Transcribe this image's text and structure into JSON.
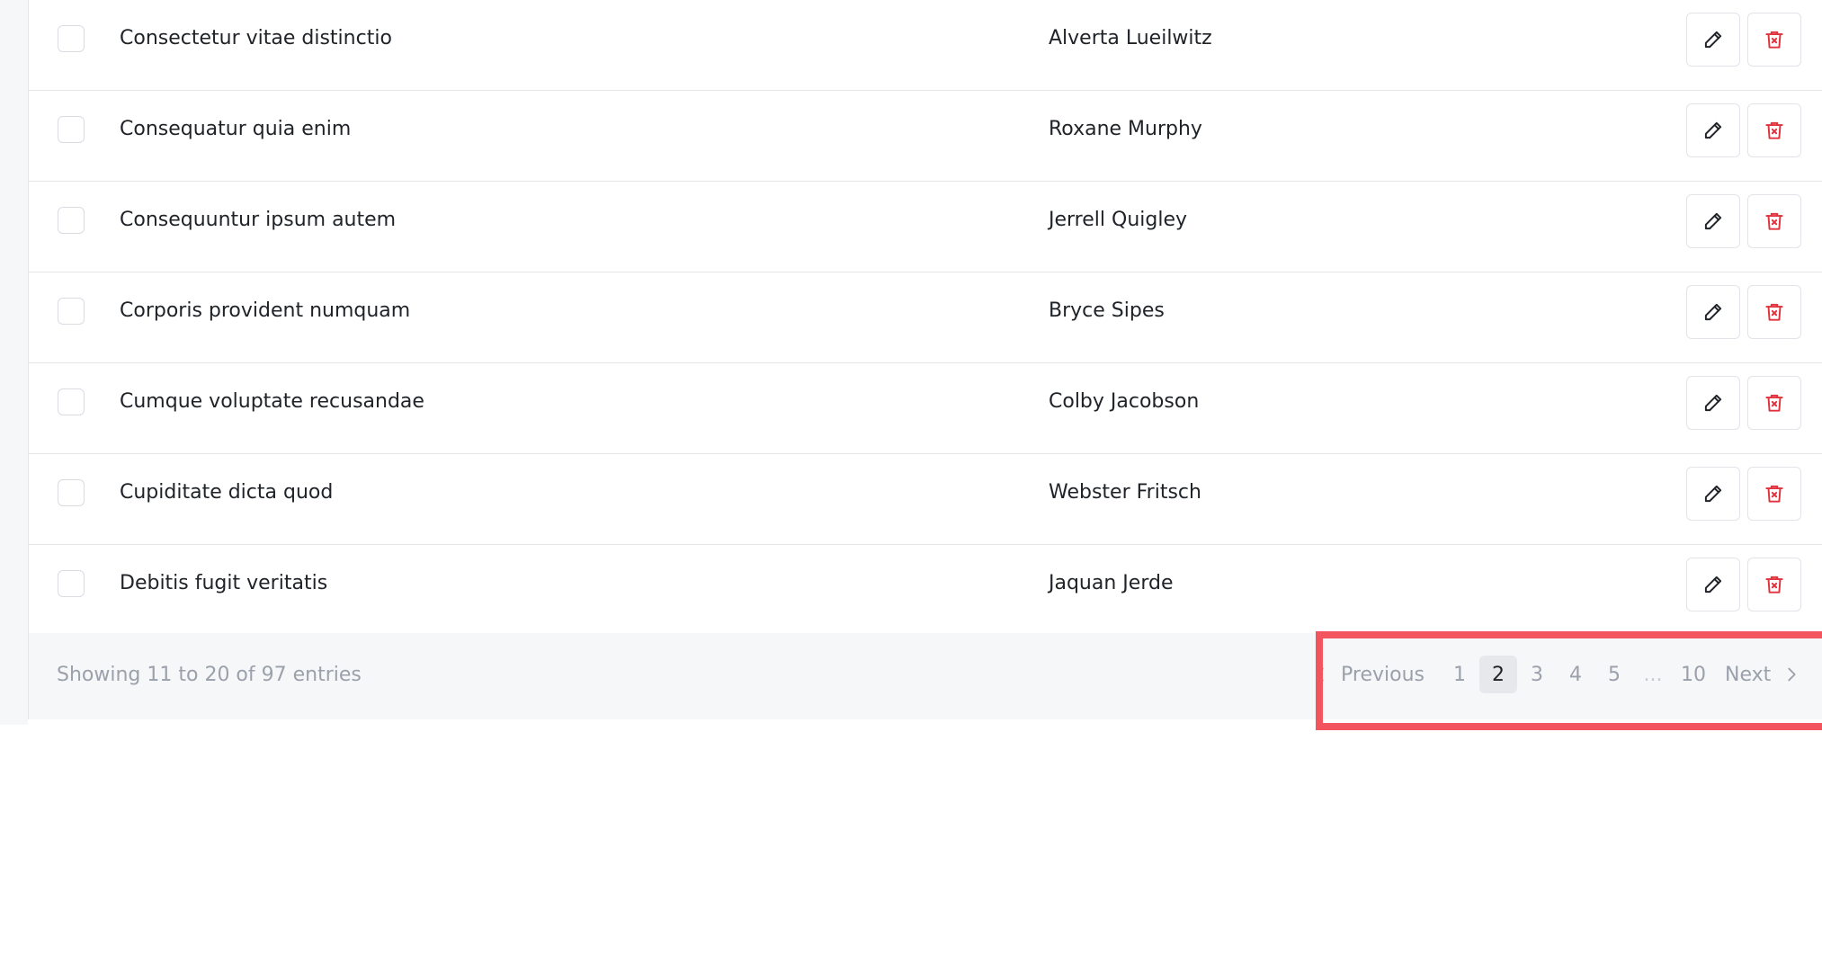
{
  "table": {
    "rows": [
      {
        "title": "Consectetur vitae distinctio",
        "author": "Alverta Lueilwitz"
      },
      {
        "title": "Consequatur quia enim",
        "author": "Roxane Murphy"
      },
      {
        "title": "Consequuntur ipsum autem",
        "author": "Jerrell Quigley"
      },
      {
        "title": "Corporis provident numquam",
        "author": "Bryce Sipes"
      },
      {
        "title": "Cumque voluptate recusandae",
        "author": "Colby Jacobson"
      },
      {
        "title": "Cupiditate dicta quod",
        "author": "Webster Fritsch"
      },
      {
        "title": "Debitis fugit veritatis",
        "author": "Jaquan Jerde"
      }
    ],
    "row_actions": {
      "edit_icon": "pencil-icon",
      "delete_icon": "trash-icon"
    }
  },
  "footer": {
    "showing_text": "Showing 11 to 20 of 97 entries"
  },
  "pagination": {
    "previous_label": "Previous",
    "next_label": "Next",
    "pages": [
      "1",
      "2",
      "3",
      "4",
      "5"
    ],
    "ellipsis": "...",
    "last_page": "10",
    "current_page": "2"
  },
  "colors": {
    "accent_delete": "#e0323c",
    "highlight": "#f2555e",
    "footer_bg": "#f6f7f9",
    "active_page_bg": "#e6e8ec"
  }
}
